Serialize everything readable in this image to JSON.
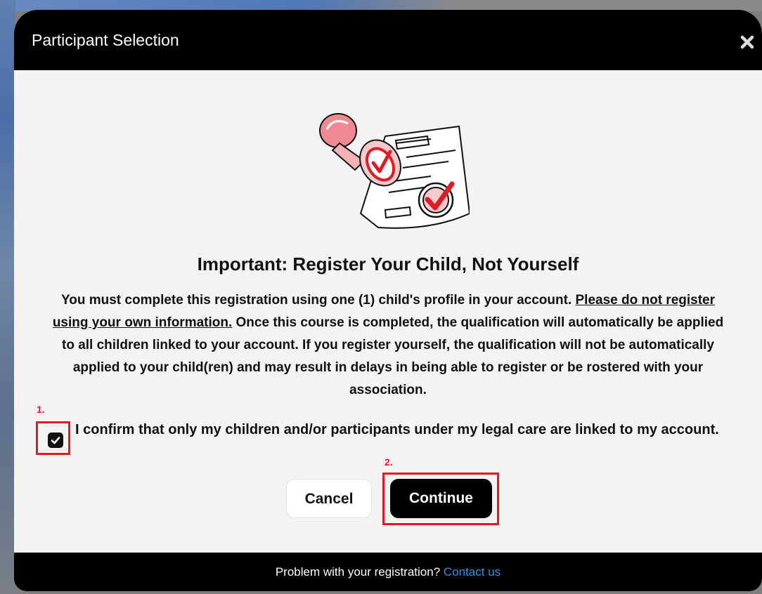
{
  "modal": {
    "title": "Participant Selection",
    "close_icon": "close-icon"
  },
  "illustration": {
    "icon": "document-stamp-icon",
    "accent_color": "#e01b24"
  },
  "content": {
    "heading": "Important: Register Your Child, Not Yourself",
    "notice_part1": "You must complete this registration using one (1) child's profile in your account. ",
    "notice_underlined": "Please do not register using your own information.",
    "notice_part2": " Once this course is completed, the qualification will automatically be applied to all children linked to your account. If you register yourself, the qualification will not be automatically applied to your child(ren) and may result in delays in being able to register or be rostered with your association."
  },
  "annotations": {
    "step1": "1.",
    "step2": "2.",
    "highlight_color": "#e01b24"
  },
  "confirm": {
    "checked": true,
    "label": "I confirm that only my children and/or participants under my legal care are linked to my account."
  },
  "buttons": {
    "cancel_label": "Cancel",
    "continue_label": "Continue"
  },
  "footer": {
    "text": "Problem with your registration? ",
    "link_label": "Contact us"
  }
}
